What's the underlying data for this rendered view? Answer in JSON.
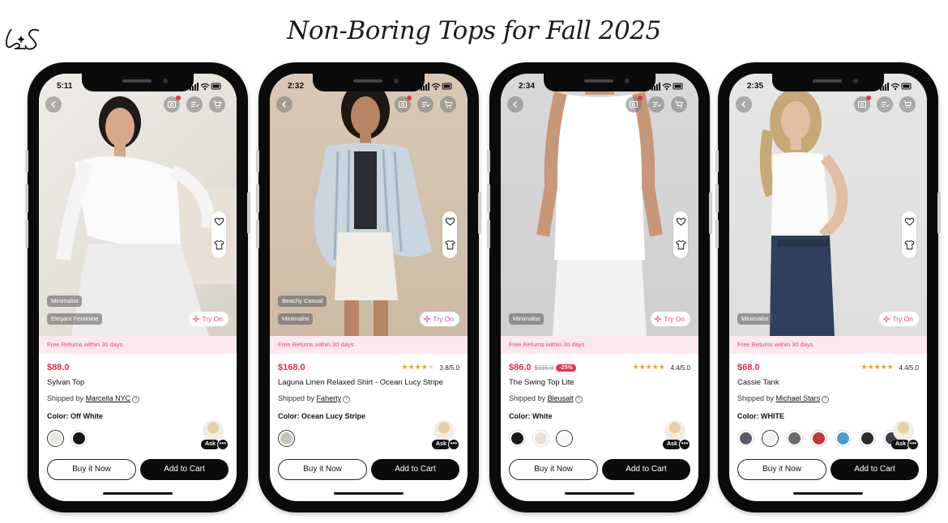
{
  "page": {
    "title": "Non-Boring Tops for Fall 2025",
    "logo_text": "LS"
  },
  "colors": {
    "accent": "#e22d4a",
    "banner_bg": "#fde8ef",
    "button_dark": "#0b0b0b"
  },
  "icons": [
    "back-chevron-icon",
    "image-search-icon",
    "list-icon",
    "cart-icon",
    "heart-icon",
    "shirt-icon",
    "sparkle-icon",
    "help-icon",
    "more-icon"
  ],
  "common": {
    "returns": "Free Returns within 30 days",
    "try_on": "Try On",
    "buy_now": "Buy it Now",
    "add_to_cart": "Add to Cart",
    "ask": "Ask",
    "shipped_by": "Shipped by",
    "color_prefix": "Color:"
  },
  "phones": [
    {
      "time": "5:11",
      "tags": [
        "Minimalist",
        "Elegant Feminine"
      ],
      "price": "$88.0",
      "price_old": "",
      "discount": "",
      "rating": null,
      "rating_text": "",
      "name": "Sylvan Top",
      "brand": "Marcella NYC",
      "color": "Off White",
      "swatches": [
        "#e9e6e2",
        "#151515"
      ],
      "selected_swatch": 0
    },
    {
      "time": "2:32",
      "tags": [
        "Beachy Casual",
        "Minimalist"
      ],
      "price": "$168.0",
      "price_old": "",
      "discount": "",
      "rating": 3.8,
      "rating_text": "3.8/5.0",
      "name": "Laguna Linen Relaxed Shirt - Ocean Lucy Stripe",
      "brand": "Faherty",
      "color": "Ocean Lucy Stripe",
      "swatches": [
        "#c9c4bb"
      ],
      "selected_swatch": 0
    },
    {
      "time": "2:34",
      "tags": [
        "Minimalist"
      ],
      "price": "$86.0",
      "price_old": "$115.0",
      "discount": "-25%",
      "rating": 4.4,
      "rating_text": "4.4/5.0",
      "name": "The Swing Top Lite",
      "brand": "Bleusalt",
      "color": "White",
      "swatches": [
        "#1a1a1a",
        "#e8e2d6",
        "#f7f7f7"
      ],
      "selected_swatch": 2
    },
    {
      "time": "2:35",
      "tags": [
        "Minimalist"
      ],
      "price": "$68.0",
      "price_old": "",
      "discount": "",
      "rating": 4.4,
      "rating_text": "4.4/5.0",
      "name": "Cassie Tank",
      "brand": "Michael Stars",
      "color": "WHITE",
      "swatches": [
        "#5a5a66",
        "#f2f2f2",
        "#6a6a6a",
        "#c8343a",
        "#44a0c8",
        "#2b2b2b",
        "#3c3f46"
      ],
      "selected_swatch": 1
    }
  ]
}
